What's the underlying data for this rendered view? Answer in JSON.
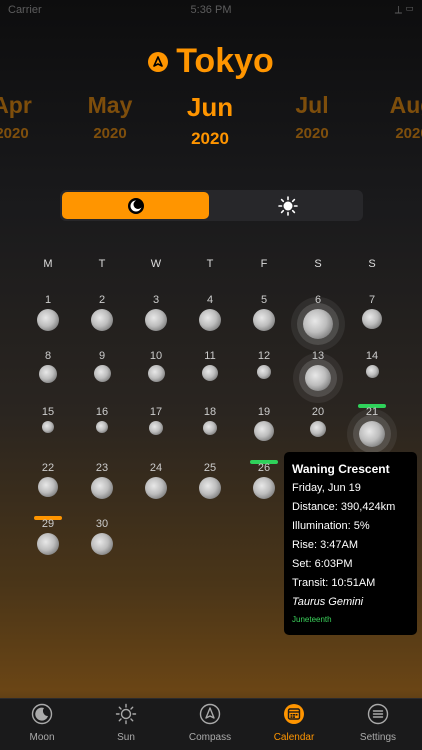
{
  "status": {
    "carrier": "Carrier",
    "time": "5:36 PM",
    "right": "⟂ ▭"
  },
  "location": {
    "city": "Tokyo"
  },
  "months": [
    {
      "name": "Apr",
      "year": "2020"
    },
    {
      "name": "May",
      "year": "2020"
    },
    {
      "name": "Jun",
      "year": "2020",
      "current": true
    },
    {
      "name": "Jul",
      "year": "2020"
    },
    {
      "name": "Aug",
      "year": "2020"
    }
  ],
  "center_year_ghost": "2020",
  "toggle": {
    "moon_icon": "moon-icon",
    "sun_icon": "sun-icon"
  },
  "weekdays": [
    "M",
    "T",
    "W",
    "T",
    "F",
    "S",
    "S"
  ],
  "days": [
    {
      "d": "1"
    },
    {
      "d": "2"
    },
    {
      "d": "3"
    },
    {
      "d": "4"
    },
    {
      "d": "5"
    },
    {
      "d": "6"
    },
    {
      "d": "7"
    },
    {
      "d": "8"
    },
    {
      "d": "9"
    },
    {
      "d": "10"
    },
    {
      "d": "11"
    },
    {
      "d": "12"
    },
    {
      "d": "13"
    },
    {
      "d": "14"
    },
    {
      "d": "15"
    },
    {
      "d": "16"
    },
    {
      "d": "17"
    },
    {
      "d": "18"
    },
    {
      "d": "19"
    },
    {
      "d": "20"
    },
    {
      "d": "21"
    },
    {
      "d": "22"
    },
    {
      "d": "23"
    },
    {
      "d": "24"
    },
    {
      "d": "25"
    },
    {
      "d": "26"
    },
    {
      "d": ""
    },
    {
      "d": ""
    },
    {
      "d": "29"
    },
    {
      "d": "30"
    }
  ],
  "popup": {
    "phase": "Waning Crescent",
    "date": "Friday, Jun 19",
    "distance": "Distance: 390,424km",
    "illumination": "Illumination: 5%",
    "rise": "Rise: 3:47AM",
    "set": "Set: 6:03PM",
    "transit": "Transit: 10:51AM",
    "constellation": "Taurus Gemini",
    "holiday": "Juneteenth"
  },
  "tabs": [
    {
      "label": "Moon",
      "icon": "moon-icon"
    },
    {
      "label": "Sun",
      "icon": "sun-icon"
    },
    {
      "label": "Compass",
      "icon": "compass-icon"
    },
    {
      "label": "Calendar",
      "icon": "calendar-icon",
      "active": true
    },
    {
      "label": "Settings",
      "icon": "settings-icon"
    }
  ],
  "colors": {
    "accent": "#ff9500",
    "underline_green": "#2fd15a",
    "underline_orange": "#ff9500"
  }
}
